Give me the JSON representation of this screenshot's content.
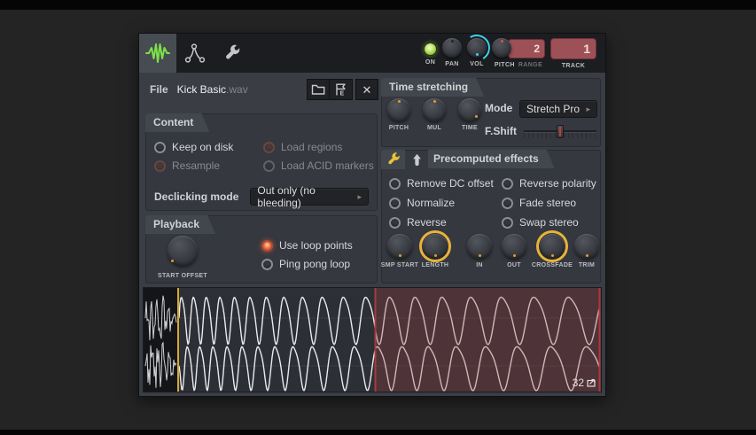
{
  "titlebar": {
    "on_label": "ON",
    "pan_label": "PAN",
    "vol_label": "VOL",
    "pitch_label": "PITCH",
    "range_label": "RANGE",
    "range_value": "2",
    "track_label": "TRACK",
    "track_value": "1"
  },
  "file": {
    "label": "File",
    "name": "Kick Basic",
    "ext": ".wav"
  },
  "content": {
    "title": "Content",
    "checkboxes": [
      {
        "label": "Keep on disk",
        "led": "gray",
        "enabled": true
      },
      {
        "label": "Load regions",
        "led": "red-dim",
        "enabled": false
      },
      {
        "label": "Resample",
        "led": "red-dim",
        "enabled": false
      },
      {
        "label": "Load ACID markers",
        "led": "gray-dim",
        "enabled": false
      }
    ],
    "declicking_label": "Declicking mode",
    "declicking_value": "Out only (no bleeding)"
  },
  "playback": {
    "title": "Playback",
    "start_offset_label": "START OFFSET",
    "checkboxes": [
      {
        "label": "Use loop points",
        "checked": true
      },
      {
        "label": "Ping pong loop",
        "checked": false
      }
    ]
  },
  "time_stretching": {
    "title": "Time stretching",
    "knobs": [
      {
        "label": "PITCH"
      },
      {
        "label": "MUL"
      },
      {
        "label": "TIME"
      }
    ],
    "mode_label": "Mode",
    "mode_value": "Stretch Pro",
    "fshift_label": "F.Shift"
  },
  "precomputed": {
    "title": "Precomputed effects",
    "checkboxes": [
      {
        "label": "Remove DC offset",
        "checked": false
      },
      {
        "label": "Reverse polarity",
        "checked": false
      },
      {
        "label": "Normalize",
        "checked": false
      },
      {
        "label": "Fade stereo",
        "checked": false
      },
      {
        "label": "Reverse",
        "checked": false
      },
      {
        "label": "Swap stereo",
        "checked": false
      }
    ],
    "knobs": [
      {
        "label": "SMP START",
        "ring": false
      },
      {
        "label": "LENGTH",
        "ring": true
      },
      {
        "label": "IN",
        "ring": false
      },
      {
        "label": "OUT",
        "ring": false
      },
      {
        "label": "CROSSFADE",
        "ring": true
      },
      {
        "label": "TRIM",
        "ring": false
      }
    ]
  },
  "waveform": {
    "length_badge": "32"
  },
  "colors": {
    "accent_green": "#7de04a",
    "accent_cyan": "#3fd2f0",
    "accent_yellow": "#e7b33a",
    "accent_orange": "#e09a38",
    "badge_red": "#9d5056",
    "selection_red": "#9e3e40",
    "marker_yellow": "#d9a82f"
  }
}
